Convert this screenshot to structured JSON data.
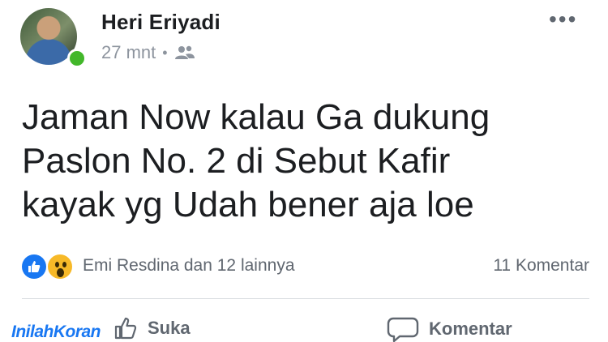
{
  "post": {
    "author_name": "Heri Eriyadi",
    "timestamp": "27 mnt",
    "separator": "•",
    "privacy_icon": "group-icon",
    "more_icon": "more-horizontal-icon",
    "more_label": "•••",
    "text_lines": [
      "Jaman Now kalau Ga dukung",
      "Paslon No. 2 di Sebut Kafir",
      "kayak yg Udah bener aja loe"
    ]
  },
  "reactions": {
    "icons": [
      "like-icon",
      "wow-icon"
    ],
    "summary": "Emi Resdina dan 12 lainnya",
    "comments_count": "11 Komentar"
  },
  "actions": {
    "like_label": "Suka",
    "comment_label": "Komentar"
  },
  "watermark": "InilahKoran",
  "colors": {
    "accent": "#1877f2",
    "online": "#42b72a",
    "wow": "#f7b928",
    "muted_text": "#606770"
  }
}
